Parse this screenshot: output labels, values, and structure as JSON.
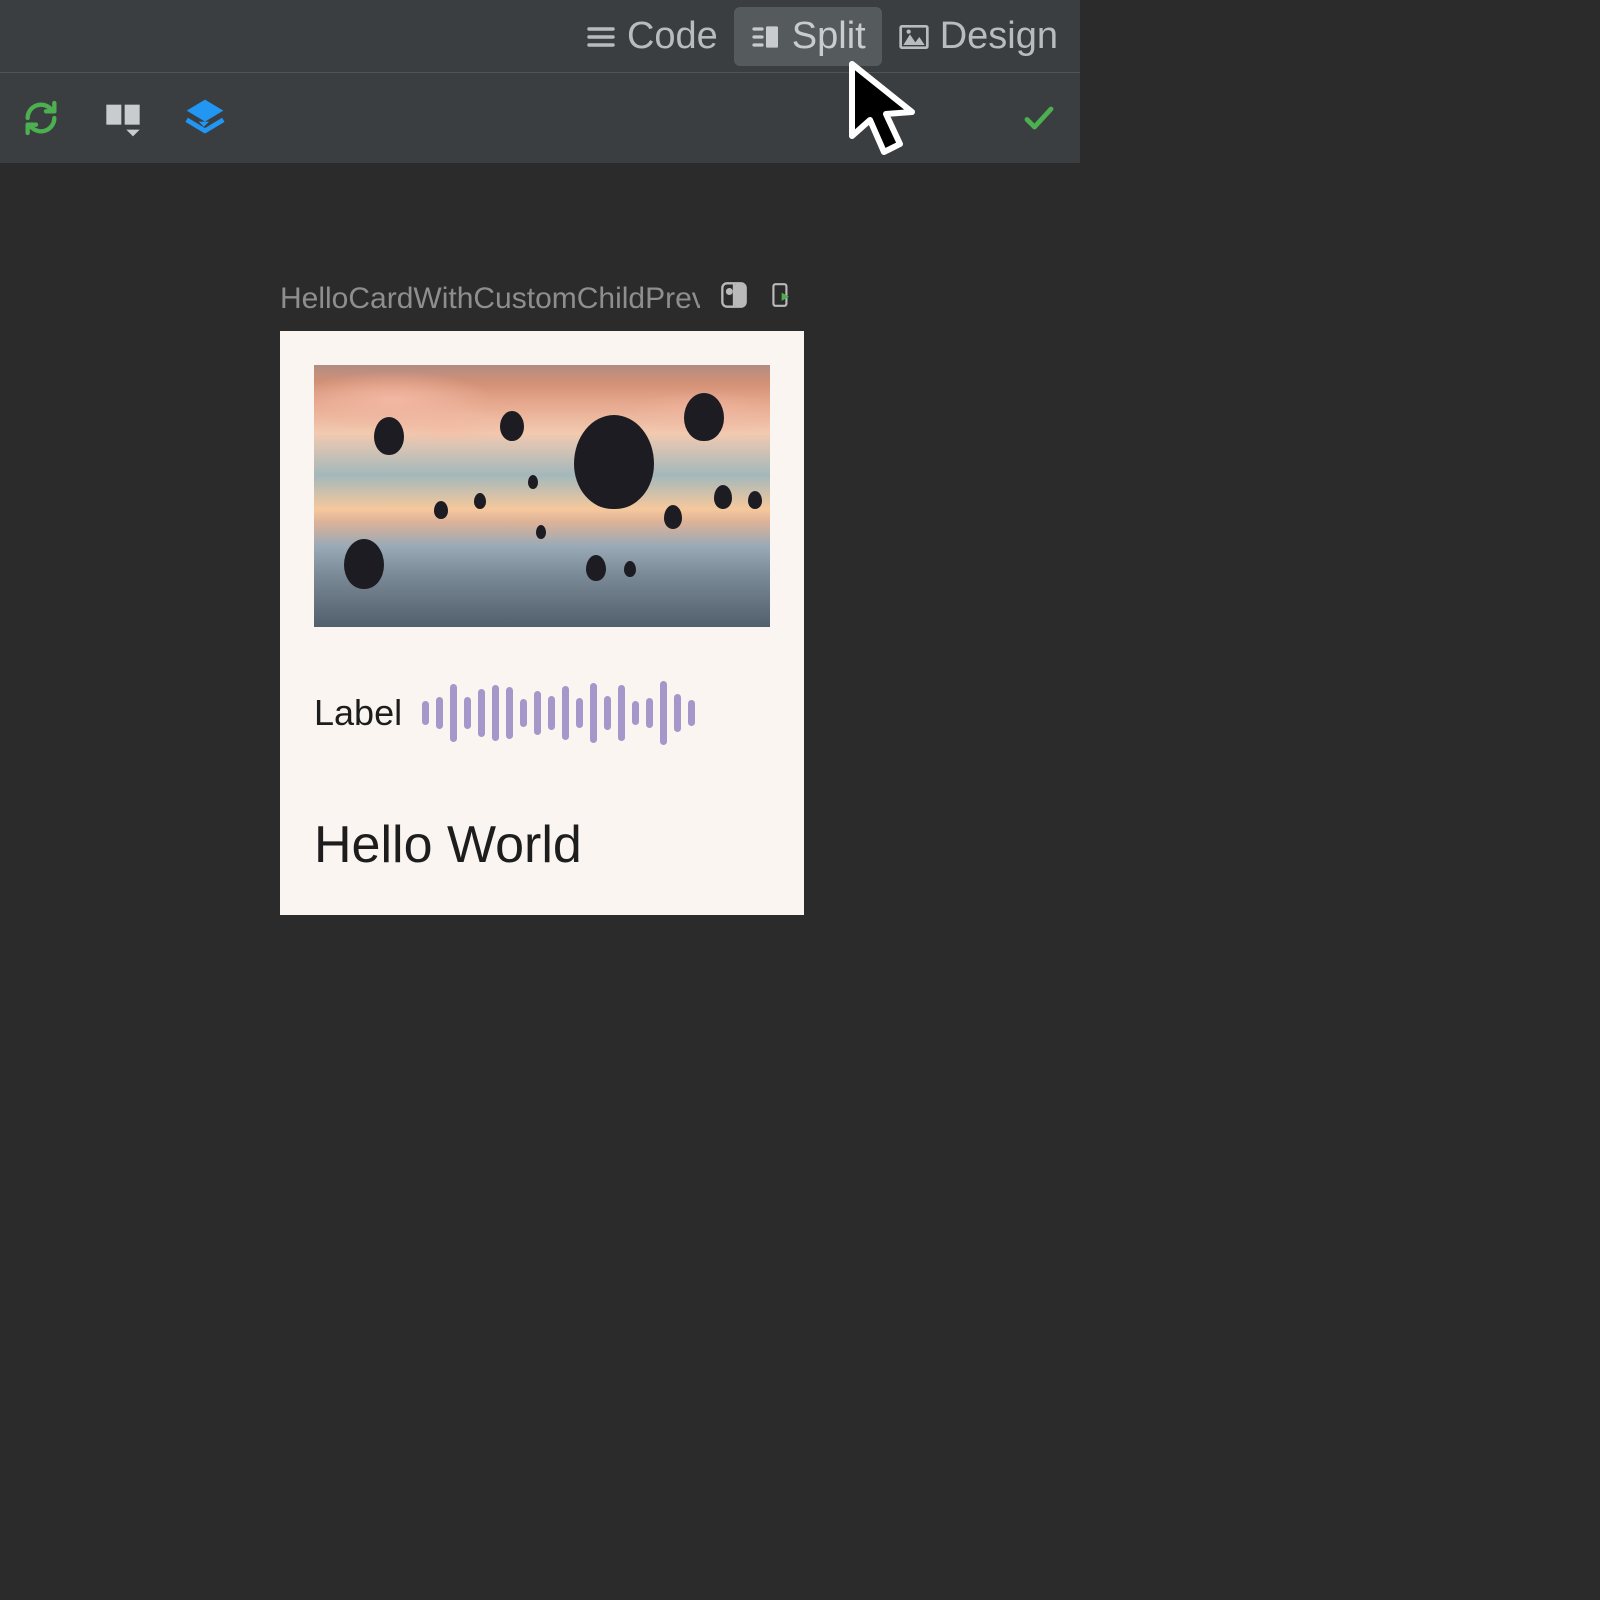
{
  "viewTabs": {
    "code": "Code",
    "split": "Split",
    "design": "Design",
    "active": "split"
  },
  "preview": {
    "title": "HelloCardWithCustomChildPrev..."
  },
  "card": {
    "label": "Label",
    "title": "Hello World"
  },
  "waveform": {
    "heights": [
      24,
      32,
      58,
      32,
      48,
      56,
      52,
      28,
      44,
      34,
      54,
      30,
      60,
      34,
      56,
      24,
      30,
      64,
      38,
      26
    ]
  },
  "colors": {
    "accentGreen": "#4caf50",
    "accentBlue": "#2196f3",
    "waveBar": "#a597c9"
  }
}
